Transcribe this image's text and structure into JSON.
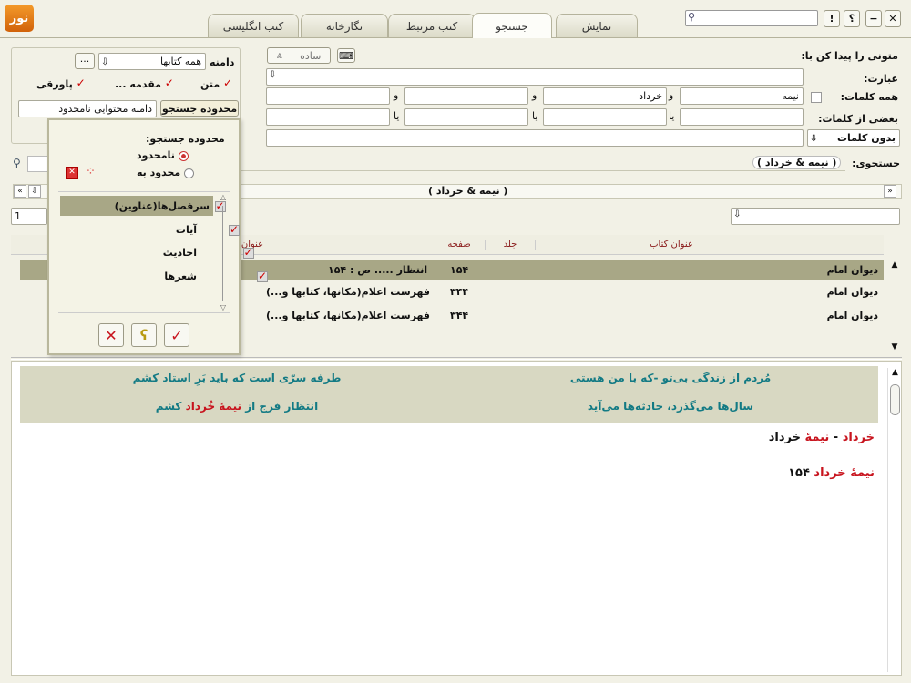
{
  "window": {
    "logo": "نور",
    "search_placeholder": "",
    "btn_help": "؟",
    "btn_min": "−",
    "btn_close": "✕"
  },
  "tabs": [
    "نمایش",
    "جستجو",
    "کتب مرتبط",
    "نگارخانه",
    "کتب انگلیسی"
  ],
  "search": {
    "find_label": "متونی را پیدا کن با:",
    "phrase_label": "عبارت:",
    "mode_label": "ساده",
    "all_words_label": "همه کلمات:",
    "some_words_label": "بعضی از کلمات:",
    "without_label": "بدون کلمات",
    "all_words": [
      "نیمه",
      "خرداد",
      "",
      ""
    ],
    "and_sep": "و",
    "or_sep": "یا",
    "query_label": "جستجوی:",
    "query_text": "( نیمه & خرداد )",
    "query_text2": "( نیمه & خرداد )",
    "page_num": "1"
  },
  "scope": {
    "domain_label": "دامنه",
    "domain_value": "همه کتابها",
    "text_label": "متن",
    "intro_label": "مقدمه ...",
    "footnote_label": "پاورقی",
    "range_btn": "محدوده جستجو",
    "range_value": "دامنه محتوایی نامحدود"
  },
  "popup": {
    "title": "محدوده جستجو:",
    "unlimited": "نامحدود",
    "limited": "محدود به",
    "items": [
      "سرفصل‌ها(عناوین)",
      "آیات",
      "احادیث",
      "شعرها"
    ]
  },
  "results": {
    "columns": [
      "عنوان کتاب",
      "جلد",
      "صفحه",
      "عنوان"
    ],
    "rows": [
      {
        "book": "دیوان امام",
        "vol": "",
        "page": "۱۵۴",
        "title": "انتظار ..... ص : ۱۵۴"
      },
      {
        "book": "دیوان امام",
        "vol": "",
        "page": "۳۴۴",
        "title": "فهرست اعلام(مکانها، کتابها و...)"
      },
      {
        "book": "دیوان امام",
        "vol": "",
        "page": "۳۴۴",
        "title": "فهرست اعلام(مکانها، کتابها و...)"
      }
    ]
  },
  "preview": {
    "verse1_right": "مُردم از زندگی بی‌تو -که با من هستی",
    "verse1_left": "طرفه سرّی است که باید بَرِ استاد کشم",
    "verse2_right": "سال‌ها می‌گذرد، حادثه‌ها می‌آید",
    "verse2_left_a": "انتظار فرج از ",
    "verse2_left_b": "نیمۀ خُرداد",
    "verse2_left_c": " کشم",
    "line1_a": "خرداد",
    "line1_b": " - ",
    "line1_c": "نیمۀ",
    "line1_d": " خرداد",
    "line2_a": "نیمۀ خرداد",
    "line2_b": " ۱۵۴"
  },
  "colors": {
    "accent_red": "#c8141e",
    "verse_teal": "#127a84",
    "selected_row": "#a8a786"
  }
}
